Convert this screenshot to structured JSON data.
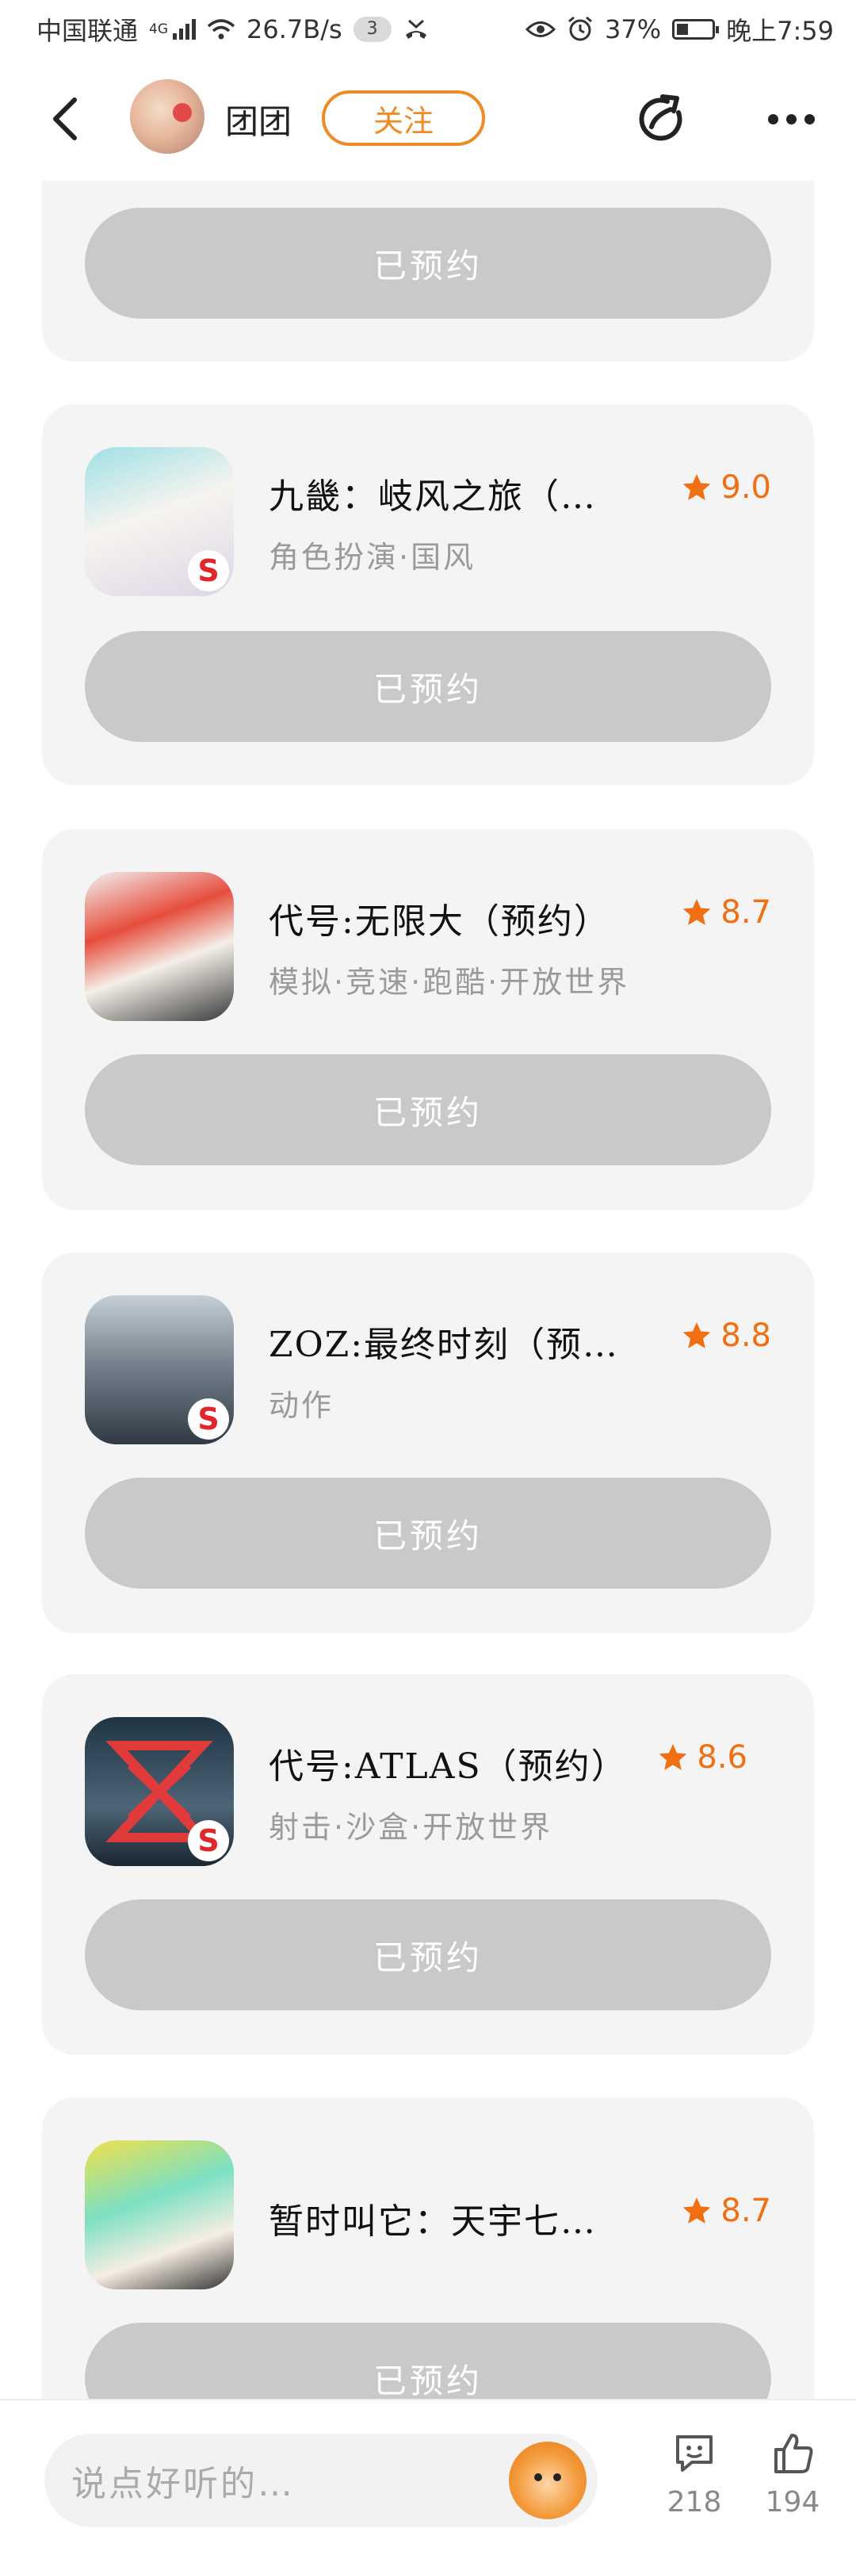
{
  "status_bar": {
    "carrier": "中国联通",
    "network": "4G",
    "speed": "26.7B/s",
    "notification_count": "3",
    "battery": "37%",
    "time": "晚上7:59"
  },
  "header": {
    "username": "团团",
    "follow_label": "关注"
  },
  "games": [
    {
      "name": "",
      "tags": "",
      "rating": "",
      "button_label": "已预约"
    },
    {
      "name": "九畿：岐风之旅（…",
      "tags": "角色扮演·国风",
      "rating": "9.0",
      "button_label": "已预约"
    },
    {
      "name": "代号:无限大（预约）",
      "tags": "模拟·竞速·跑酷·开放世界",
      "rating": "8.7",
      "button_label": "已预约"
    },
    {
      "name": "ZOZ:最终时刻（预…",
      "tags": "动作",
      "rating": "8.8",
      "button_label": "已预约"
    },
    {
      "name": "代号:ATLAS（预约）",
      "tags": "射击·沙盒·开放世界",
      "rating": "8.6",
      "button_label": "已预约"
    },
    {
      "name": "暂时叫它：天宇七…",
      "tags": "",
      "rating": "8.7",
      "button_label": "已预约"
    }
  ],
  "bottom_bar": {
    "comment_placeholder": "说点好听的…",
    "comment_count": "218",
    "like_count": "194"
  },
  "colors": {
    "accent": "#f08a24",
    "rating": "#f06f12",
    "card_bg": "#f4f4f4",
    "button_bg": "#c9c9c9"
  }
}
